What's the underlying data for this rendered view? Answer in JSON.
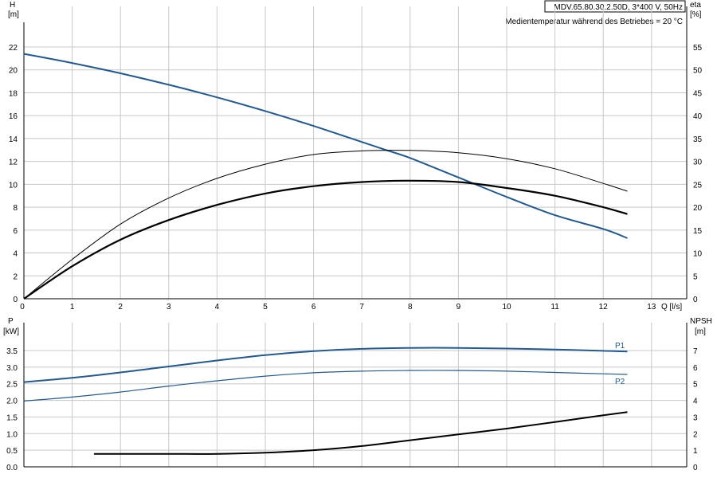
{
  "header": {
    "model_label": "MDV.65.80.30.2.50D, 3*400 V, 50Hz",
    "note": "Medientemperatur während des Betriebes = 20 °C"
  },
  "chart_data": [
    {
      "type": "line",
      "name": "head-efficiency",
      "xlabel": "Q [l/s]",
      "ylabel": "H",
      "ylabel_unit": "[m]",
      "y2label": "eta",
      "y2label_unit": "[%]",
      "xlim": [
        0,
        14
      ],
      "ylim": [
        0,
        24
      ],
      "y2lim": [
        0,
        60
      ],
      "x_ticks": [
        0,
        1,
        2,
        3,
        4,
        5,
        6,
        7,
        8,
        9,
        10,
        11,
        12,
        13
      ],
      "y_ticks": [
        0,
        2,
        4,
        6,
        8,
        10,
        12,
        14,
        16,
        18,
        20,
        22
      ],
      "y2_ticks": [
        0,
        5,
        10,
        15,
        20,
        25,
        30,
        35,
        40,
        45,
        50,
        55
      ],
      "grid": true,
      "colors": {
        "head": "#1f5a96",
        "eta": "#000000"
      },
      "series": [
        {
          "id": "head",
          "axis": "left",
          "color": "#1f5a96",
          "width": 2,
          "x": [
            0,
            1,
            2,
            3,
            4,
            5,
            6,
            7,
            7.5,
            8,
            9,
            10,
            11,
            12,
            12.5
          ],
          "y": [
            21.4,
            20.6,
            19.7,
            18.7,
            17.6,
            16.4,
            15.1,
            13.7,
            13.0,
            12.3,
            10.6,
            8.9,
            7.3,
            6.1,
            5.3
          ]
        },
        {
          "id": "eta-upper",
          "axis": "right",
          "color": "#000000",
          "width": 1,
          "x": [
            0,
            1,
            2,
            3,
            4,
            5,
            6,
            7,
            8,
            9,
            10,
            11,
            12,
            12.5
          ],
          "y": [
            0,
            8.6,
            16.3,
            22.0,
            26.3,
            29.4,
            31.5,
            32.3,
            32.4,
            31.9,
            30.6,
            28.4,
            25.2,
            23.5
          ]
        },
        {
          "id": "eta-lower",
          "axis": "right",
          "color": "#000000",
          "width": 2.2,
          "x": [
            0,
            1,
            2,
            3,
            4,
            5,
            6,
            7,
            8,
            9,
            10,
            11,
            12,
            12.5
          ],
          "y": [
            0,
            7.1,
            12.9,
            17.2,
            20.5,
            23.0,
            24.6,
            25.5,
            25.8,
            25.5,
            24.2,
            22.5,
            20.0,
            18.5
          ]
        }
      ]
    },
    {
      "type": "line",
      "name": "power-npsh",
      "ylabel": "P",
      "ylabel_unit": "[kW]",
      "y2label": "NPSH",
      "y2label_unit": "[m]",
      "xlim": [
        0,
        14
      ],
      "ylim": [
        0,
        4
      ],
      "y2lim": [
        0,
        8
      ],
      "y_ticks": [
        0,
        0.5,
        1.0,
        1.5,
        2.0,
        2.5,
        3.0,
        3.5
      ],
      "y_tick_labels": [
        "0.0",
        "0.5",
        "1.0",
        "1.5",
        "2.0",
        "2.5",
        "3.0",
        "3.5"
      ],
      "y2_ticks": [
        0,
        1,
        2,
        3,
        4,
        5,
        6,
        7
      ],
      "grid": true,
      "series": [
        {
          "id": "P1",
          "name": "P1",
          "axis": "left",
          "color": "#1f5a96",
          "width": 2,
          "x": [
            0,
            1,
            2,
            3,
            4,
            5,
            6,
            7,
            8,
            9,
            10,
            11,
            12,
            12.5
          ],
          "y": [
            2.55,
            2.68,
            2.84,
            3.02,
            3.2,
            3.36,
            3.48,
            3.55,
            3.58,
            3.58,
            3.56,
            3.53,
            3.49,
            3.47
          ]
        },
        {
          "id": "P2",
          "name": "P2",
          "axis": "left",
          "color": "#1f5a96",
          "width": 1.2,
          "x": [
            0,
            1,
            2,
            3,
            4,
            5,
            6,
            7,
            8,
            9,
            10,
            11,
            12,
            12.5
          ],
          "y": [
            1.98,
            2.1,
            2.25,
            2.43,
            2.59,
            2.73,
            2.83,
            2.88,
            2.9,
            2.9,
            2.88,
            2.84,
            2.8,
            2.78
          ]
        },
        {
          "id": "NPSH",
          "axis": "right",
          "color": "#000000",
          "width": 2,
          "x": [
            1.45,
            2,
            3,
            4,
            5,
            6,
            7,
            8,
            9,
            10,
            11,
            12,
            12.5
          ],
          "y": [
            0.78,
            0.78,
            0.78,
            0.78,
            0.85,
            1.0,
            1.25,
            1.6,
            1.95,
            2.3,
            2.7,
            3.1,
            3.3
          ]
        }
      ],
      "legend_labels": {
        "P1": "P1",
        "P2": "P2"
      }
    }
  ]
}
